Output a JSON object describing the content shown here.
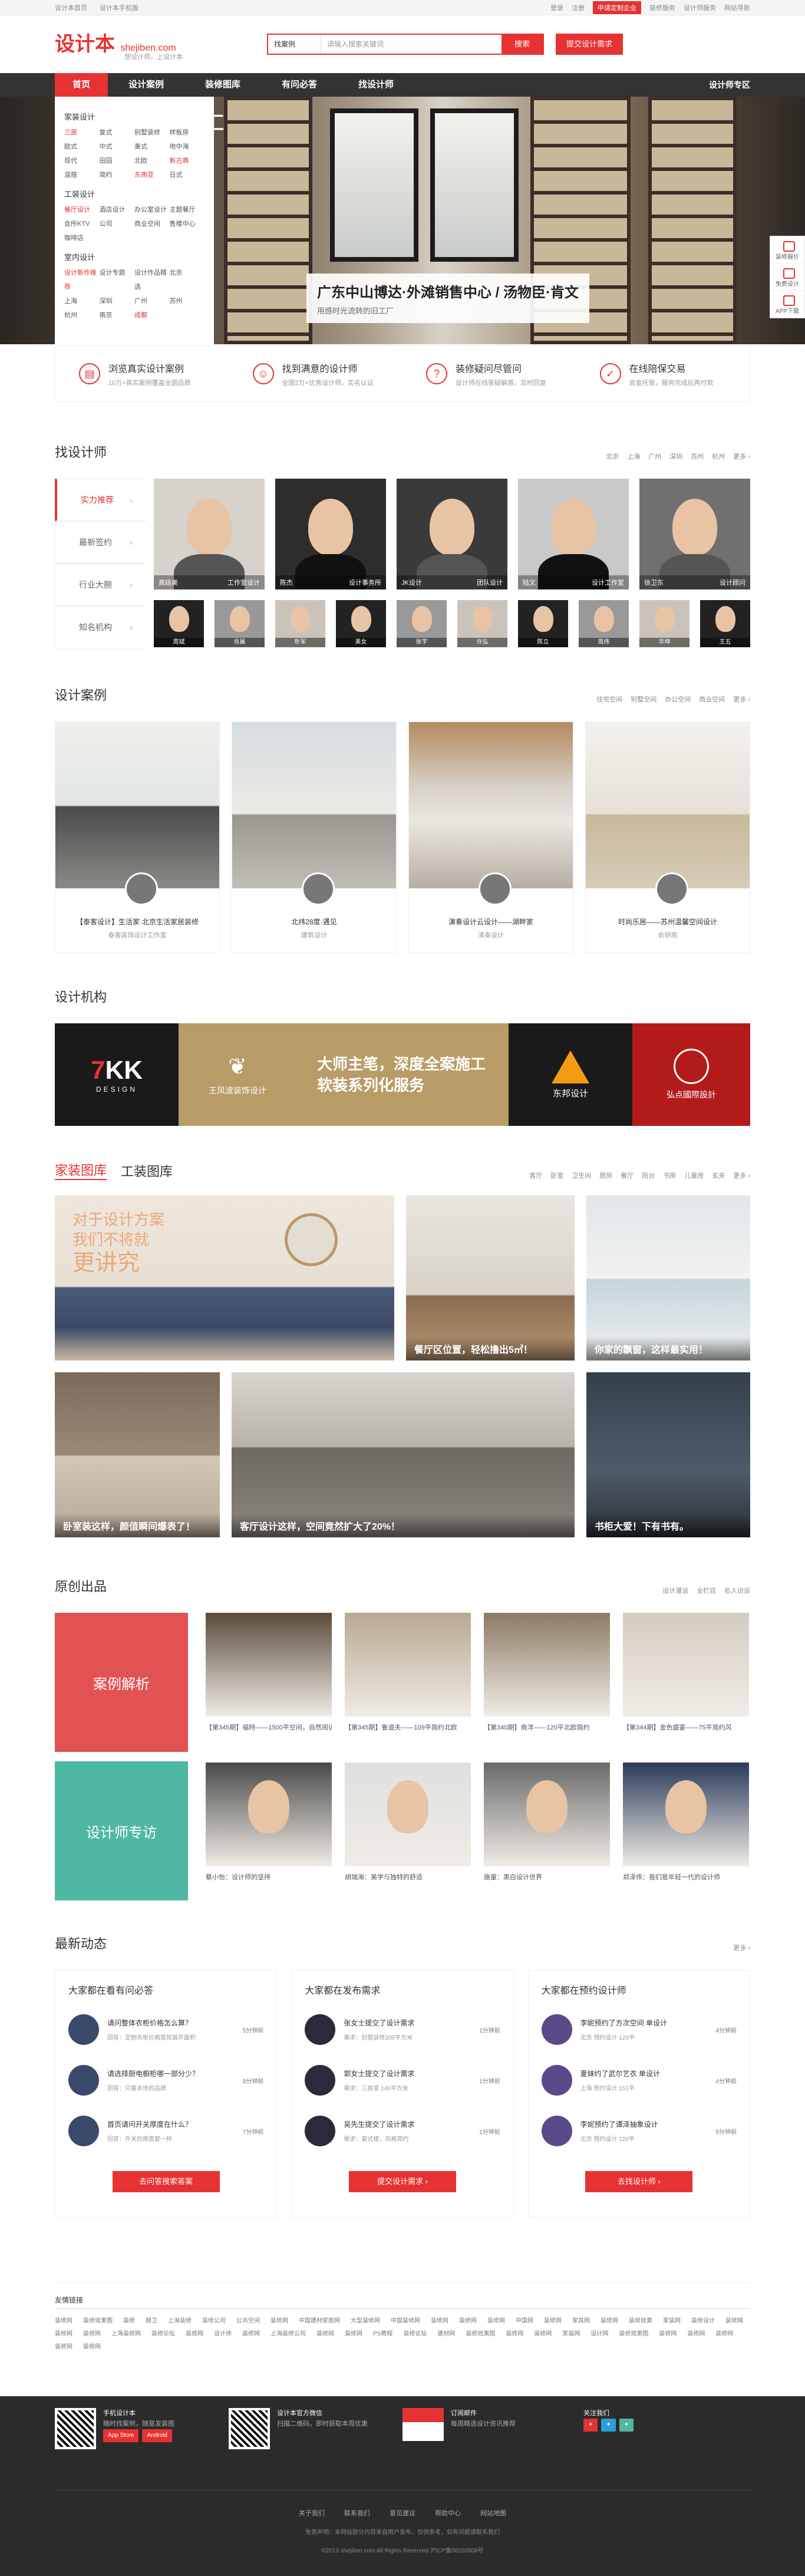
{
  "topbar": {
    "left": [
      "设计本首页",
      "设计本手机版"
    ],
    "right": [
      "登录",
      "注册",
      "申请定制企业",
      "装修服务",
      "设计师服务",
      "网站导航"
    ]
  },
  "header": {
    "logo_cn": "设计本",
    "logo_en": "shejiben",
    "logo_en_suffix": ".com",
    "slogan": "想设计师，上设计本",
    "search_select": "找案例",
    "search_placeholder": "请输入搜索关键词",
    "search_btn": "搜索",
    "publish_btn": "提交设计需求"
  },
  "nav": {
    "items": [
      "首页",
      "设计案例",
      "装修图库",
      "有问必答",
      "找设计师"
    ],
    "right": "设计师专区"
  },
  "dropdown": {
    "home_title": "家装设计",
    "home": [
      [
        "三居",
        "复式",
        "别墅装修",
        "样板房"
      ],
      [
        "欧式",
        "中式",
        "美式",
        "地中海"
      ],
      [
        "现代",
        "田园",
        "北欧",
        "新古典"
      ],
      [
        "混搭",
        "简约",
        "东南亚",
        "日式"
      ]
    ],
    "tool_title": "工装设计",
    "tool": [
      [
        "餐厅设计",
        "酒店设计",
        "办公室设计"
      ],
      [
        "主题餐厅",
        "会所KTV",
        "公司"
      ],
      [
        "商业空间",
        "售楼中心",
        "咖啡店"
      ]
    ],
    "soft_title": "室内设计",
    "soft": [
      [
        "设计新作推荐",
        "设计专题",
        "设计作品精选"
      ],
      [
        "北京",
        "上海",
        "深圳",
        "广州"
      ],
      [
        "苏州",
        "杭州",
        "南京",
        "成都"
      ]
    ]
  },
  "banner": {
    "mark": "名家汇",
    "caption": "广东中山博达·外滩销售中心 / 汤物臣·肯文",
    "sub": "用感时光流转的旧工厂"
  },
  "side_float": [
    "装修报价",
    "免费设计",
    "APP下载"
  ],
  "services": [
    {
      "title": "浏览真实设计案例",
      "sub": "10万+真实案例覆盖全国品质"
    },
    {
      "title": "找到满意的设计师",
      "sub": "全国2万+优秀设计师，实名认证"
    },
    {
      "title": "装修疑问尽管问",
      "sub": "设计师在线答疑解惑，及时回复"
    },
    {
      "title": "在线陪保交易",
      "sub": "资金托管，服务完成后再付款"
    }
  ],
  "designers": {
    "title": "找设计师",
    "tags": [
      "北京",
      "上海",
      "广州",
      "深圳",
      "苏州",
      "杭州",
      "更多 ›"
    ],
    "tabs": [
      "实力推荐",
      "最新签约",
      "行业大腕",
      "知名机构"
    ],
    "big": [
      [
        "高级美",
        "工作室设计"
      ],
      [
        "陈杰",
        "设计事务所"
      ],
      [
        "JK设计",
        "团队设计"
      ],
      [
        "陆文",
        "设计工作室"
      ],
      [
        "徐卫东",
        "设计顾问"
      ]
    ],
    "small": [
      "周斌",
      "肖晨",
      "朴军",
      "美女",
      "张宇",
      "许弘",
      "陈立",
      "周伟",
      "华坤",
      "王五"
    ]
  },
  "cases": {
    "title": "设计案例",
    "tags": [
      "住宅空间",
      "别墅空间",
      "办公空间",
      "商业空间",
      "更多 ›"
    ],
    "items": [
      {
        "title": "【泰客设计】生活家·北京生活家居装修",
        "sub": "泰客装饰设计工作室"
      },
      {
        "title": "北纬28度·遇见",
        "sub": "建筑设计"
      },
      {
        "title": "演奏设计云设计——湖畔家",
        "sub": "演奏设计"
      },
      {
        "title": "时尚乐居——苏州温馨空间设计",
        "sub": "俞妍雨"
      }
    ]
  },
  "orgs": {
    "title": "设计机构",
    "items": [
      "7KK DESIGN",
      "王凤波装饰设计",
      "大师主笔，深度全案施工软装系列化服务",
      "东邦设计",
      "弘点國際設計"
    ]
  },
  "gallery": {
    "tabs": [
      "家装图库",
      "工装图库"
    ],
    "tags": [
      "客厅",
      "卧室",
      "卫生间",
      "厨房",
      "餐厅",
      "阳台",
      "书房",
      "儿童房",
      "玄关",
      "更多 ›"
    ],
    "ad_line1": "对于设计方案",
    "ad_line2": "我们不将就",
    "ad_line3": "更讲究",
    "items": [
      "餐厅区位置，轻松撸出5㎡！",
      "你家的飘窗，这样最实用！",
      "卧室装这样，颜值瞬间爆表了！",
      "客厅设计这样，空间竟然扩大了20%！",
      "书柜大爱！下有书有。"
    ]
  },
  "original": {
    "title": "原创出品",
    "tags": [
      "设计漫谈",
      "全栏目",
      "名人访谈"
    ],
    "blocks": [
      "案例解析",
      "设计师专访"
    ],
    "items": [
      "【第345期】福特——1500平空间，自然阅读观景室",
      "【第345期】鲁道夫——109平简约北欧",
      "【第340期】南洋——120平北欧简约",
      "【第344期】金色盛宴——75平简约风",
      "蔡小怡：设计师的坚持",
      "胡瑞海：美学与独特的舒适",
      "施童：黑白设计世界",
      "郑泽伟：我们是年轻一代的设计师"
    ]
  },
  "news": {
    "title": "最新动态",
    "more": "更多 ›",
    "cols": [
      {
        "title": "大家都在看有问必答",
        "items": [
          [
            "请问整体衣柜价格怎么算？",
            "回答：定制衣柜价格是按展开面积",
            "5分钟前"
          ],
          [
            "请选择厨电橱柜哪一部分少？",
            "回答：只看本地的品牌",
            "9分钟前"
          ],
          [
            "首页请问开关厚度在什么？",
            "回答：开关的厚度都一样",
            "7分钟前"
          ]
        ],
        "btn": "去问答搜索答案"
      },
      {
        "title": "大家都在发布需求",
        "items": [
          [
            "张女士提交了设计需求",
            "需求：别墅装修200平方米",
            "1分钟前"
          ],
          [
            "郭女士提交了设计需求",
            "需求：三居室 140平方米",
            "1分钟前"
          ],
          [
            "吴先生提交了设计需求",
            "需求：复式楼，风格简约",
            "1分钟前"
          ]
        ],
        "btn": "提交设计需求 ›"
      },
      {
        "title": "大家都在预约设计师",
        "items": [
          [
            "李妮预约了方次空间 单设计",
            "北京 预约设计 120平",
            "4分钟前"
          ],
          [
            "夏妹约了武尔艺衣 单设计",
            "上海 预约设计 151平",
            "4分钟前"
          ],
          [
            "李妮预约了谭泽抽象设计",
            "北京 预约设计 120平",
            "5分钟前"
          ]
        ],
        "btn": "去找设计师 ›"
      }
    ]
  },
  "friends": {
    "title": "友情链接",
    "links": [
      "装修网",
      "装修效果图",
      "装修",
      "厨卫",
      "上海装修",
      "装修公司",
      "公共空间",
      "装修网",
      "中国建材家居网",
      "大型装修网",
      "中国装修网",
      "装修网",
      "装修网",
      "装修网",
      "中国网",
      "装修网",
      "家具网",
      "装修网",
      "装修效果",
      "家装网",
      "装修设计",
      "装修网",
      "装修网",
      "装修网",
      "上海装修网",
      "装修论坛",
      "装修网",
      "设计师",
      "装修网",
      "上海装修公司",
      "装修网",
      "装修网",
      "PS教程",
      "装修论坛",
      "建材网",
      "装修效果图",
      "装修网",
      "装修网",
      "家装网",
      "设计网",
      "装修效果图",
      "装修网",
      "装修网",
      "装修网",
      "装修网",
      "装修网"
    ]
  },
  "footer": {
    "app_title": "手机设计本",
    "app_desc": "随时找案例，随意发装图",
    "app_btns": [
      "App Store",
      "Android"
    ],
    "wx_title": "设计本官方微信",
    "wx_desc": "扫描二维码，即时获取本周优惠",
    "mail_title": "订阅邮件",
    "mail_desc": "每周精选设计资讯推荐",
    "follow_title": "关注我们",
    "nav": "关于我们  联系我们  意见建议  帮助中心  网站地图",
    "note": "免责声明：本网站部分内容来自用户发布，仅供参考，如有问题请联系我们",
    "copy": "©2013 shejiben.com All Rights Reserved 沪ICP备08103508号"
  },
  "colors": {
    "brand": "#e63232",
    "teal": "#4fb8a2",
    "nav": "#333333",
    "footer": "#2b2b2b"
  }
}
